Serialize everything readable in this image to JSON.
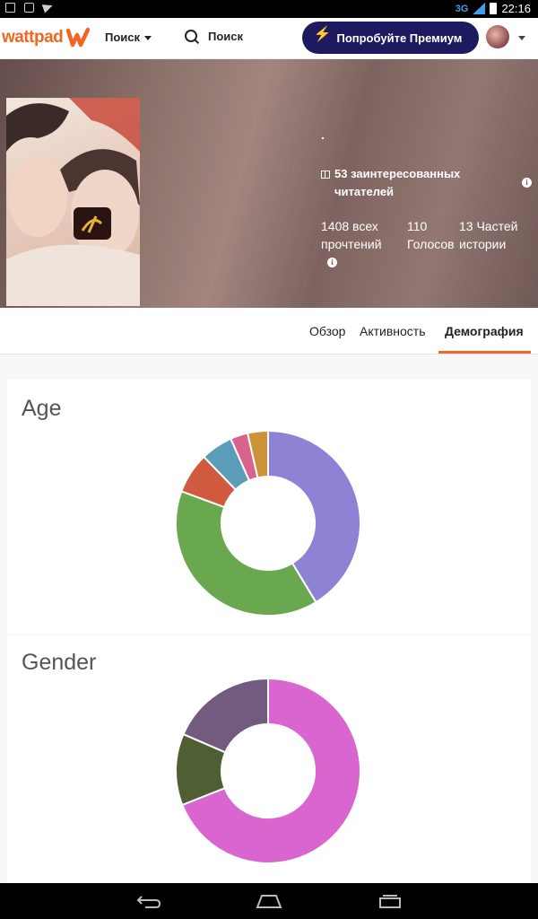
{
  "status_bar": {
    "network": "3G",
    "time": "22:16"
  },
  "header": {
    "logo_text": "wattpad",
    "browse_label": "Поиск",
    "search_label": "Поиск",
    "premium_label": "Попробуйте Премиум"
  },
  "story": {
    "title": ".",
    "readers_text": "53 заинтересованных читателей",
    "stats": [
      {
        "label": "1408 всех прочтений"
      },
      {
        "label": "110 Голосов"
      },
      {
        "label": "13 Частей истории"
      }
    ]
  },
  "tabs": [
    {
      "label": "Обзор",
      "active": false
    },
    {
      "label": "Активность",
      "active": false
    },
    {
      "label": "Демография",
      "active": true
    }
  ],
  "age_chart": {
    "title": "Age",
    "chart_data": {
      "type": "pie",
      "donut": true,
      "values": [
        40.5,
        38.5,
        7.0,
        5.5,
        3.0,
        3.5
      ],
      "colors": [
        "#8e82d4",
        "#6aa84f",
        "#cf5a3e",
        "#5b9db8",
        "#d8648e",
        "#cc9238"
      ]
    }
  },
  "gender_chart": {
    "title": "Gender",
    "chart_data": {
      "type": "pie",
      "donut": true,
      "values": [
        69,
        12.5,
        18.5
      ],
      "colors": [
        "#d966cf",
        "#4f5f33",
        "#735a7f"
      ]
    }
  }
}
